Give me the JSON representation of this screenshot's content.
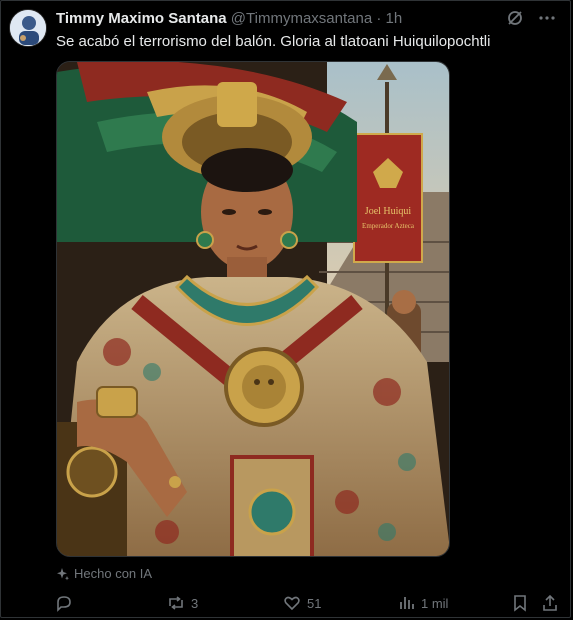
{
  "tweet": {
    "author_name": "Timmy Maximo Santana",
    "handle": "@Timmymaxsantana",
    "separator": "·",
    "time": "1h",
    "text": "Se acabó el terrorismo del balón. Gloria al tlatoani Huiquilopochtli"
  },
  "media": {
    "banner_lines": [
      "Joel Huiqui",
      "Emperador Azteca"
    ]
  },
  "ai_label": "Hecho con IA",
  "actions": {
    "reply_icon": "reply-icon",
    "retweet_count": "3",
    "like_count": "51",
    "view_count": "1 mil"
  },
  "colors": {
    "background": "#000000",
    "text": "#e7e9ea",
    "muted": "#71767b"
  }
}
